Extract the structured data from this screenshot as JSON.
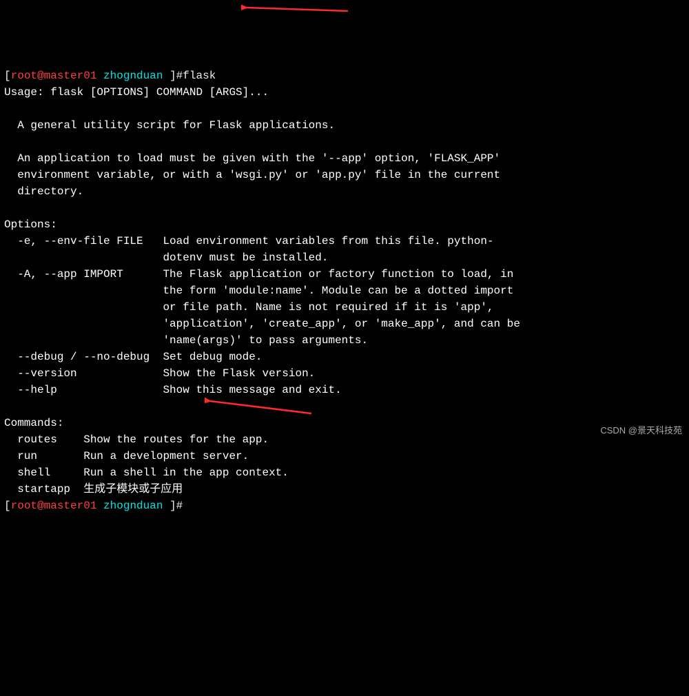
{
  "prompt1": {
    "bracket_open": "[",
    "user_host": "root@master01",
    "sep": " ",
    "cwd": "zhognduan",
    "bracket_close": " ]#",
    "command": "flask"
  },
  "usage_line": "Usage: flask [OPTIONS] COMMAND [ARGS]...",
  "desc1": "  A general utility script for Flask applications.",
  "desc2": "  An application to load must be given with the '--app' option, 'FLASK_APP'",
  "desc3": "  environment variable, or with a 'wsgi.py' or 'app.py' file in the current",
  "desc4": "  directory.",
  "options_header": "Options:",
  "opt_e1": "  -e, --env-file FILE   Load environment variables from this file. python-",
  "opt_e2": "                        dotenv must be installed.",
  "opt_a1": "  -A, --app IMPORT      The Flask application or factory function to load, in",
  "opt_a2": "                        the form 'module:name'. Module can be a dotted import",
  "opt_a3": "                        or file path. Name is not required if it is 'app',",
  "opt_a4": "                        'application', 'create_app', or 'make_app', and can be",
  "opt_a5": "                        'name(args)' to pass arguments.",
  "opt_debug": "  --debug / --no-debug  Set debug mode.",
  "opt_version": "  --version             Show the Flask version.",
  "opt_help": "  --help                Show this message and exit.",
  "commands_header": "Commands:",
  "cmd_routes": "  routes    Show the routes for the app.",
  "cmd_run": "  run       Run a development server.",
  "cmd_shell": "  shell     Run a shell in the app context.",
  "cmd_startapp_name": "  startapp  ",
  "cmd_startapp_desc": "生成子模块或子应用",
  "prompt2": {
    "bracket_open": "[",
    "user_host": "root@master01",
    "sep": " ",
    "cwd": "zhognduan",
    "bracket_close": " ]#"
  },
  "watermark": "CSDN @景天科技苑"
}
